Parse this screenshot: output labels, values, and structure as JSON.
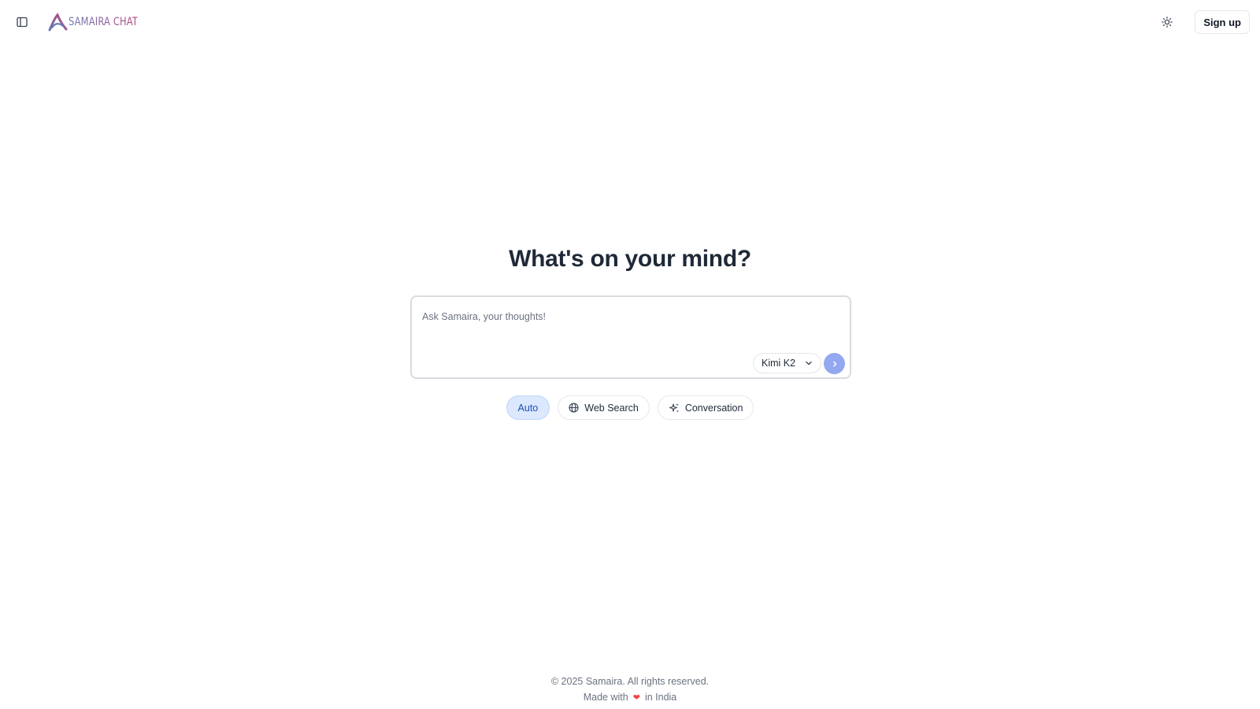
{
  "header": {
    "brand_name": "SAMAIRA CHAT",
    "signup_label": "Sign up",
    "icons": {
      "sidebar_toggle": "sidebar-panel-icon",
      "theme_toggle": "sun-icon",
      "logo": "samaira-logo-icon"
    }
  },
  "main": {
    "headline": "What's on your mind?",
    "composer": {
      "placeholder": "Ask Samaira, your thoughts!",
      "value": "",
      "model_selected": "Kimi K2",
      "send_icon": "chevron-right-icon"
    },
    "modes": [
      {
        "label": "Auto",
        "active": true,
        "icon": ""
      },
      {
        "label": "Web Search",
        "active": false,
        "icon": "globe-icon"
      },
      {
        "label": "Conversation",
        "active": false,
        "icon": "sparkles-icon"
      }
    ]
  },
  "footer": {
    "copyright": "© 2025 Samaira. All rights reserved.",
    "made_with_prefix": "Made with",
    "made_with_suffix": "in India",
    "heart_icon": "heart-icon"
  },
  "colors": {
    "accent": "#93a8f0",
    "active_chip_bg": "#dbe8fd",
    "active_chip_text": "#1e4fb7",
    "heart": "#ef4444",
    "brand_gradient_start": "#6b7ab8",
    "brand_gradient_end": "#b1467a"
  }
}
